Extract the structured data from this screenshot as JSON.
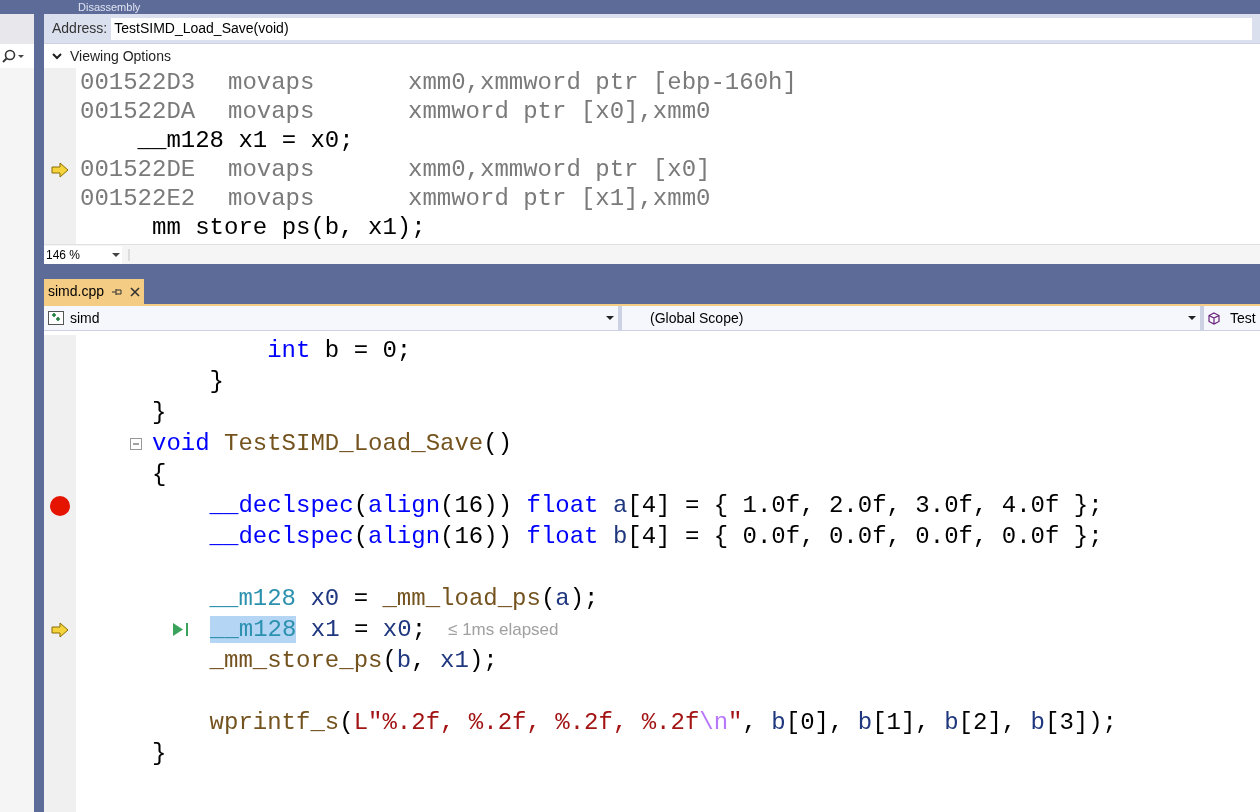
{
  "disassembly": {
    "title": "Disassembly",
    "address_label": "Address:",
    "address": "TestSIMD_Load_Save(void)",
    "viewing_options": "Viewing Options",
    "lines": [
      {
        "kind": "asm",
        "address": "001522D3",
        "mnemonic": "movaps",
        "operands": "xmm0,xmmword ptr [ebp-160h]",
        "current": false
      },
      {
        "kind": "asm",
        "address": "001522DA",
        "mnemonic": "movaps",
        "operands": "xmmword ptr [x0],xmm0",
        "current": false
      },
      {
        "kind": "source",
        "text": "    __m128 x1 = x0;"
      },
      {
        "kind": "asm",
        "address": "001522DE",
        "mnemonic": "movaps",
        "operands": "xmm0,xmmword ptr [x0]",
        "current": true
      },
      {
        "kind": "asm",
        "address": "001522E2",
        "mnemonic": "movaps",
        "operands": "xmmword ptr [x1],xmm0",
        "current": false
      },
      {
        "kind": "source",
        "text": "     mm store ps(b, x1);"
      }
    ],
    "zoom": "146 %"
  },
  "editor": {
    "tabs": [
      {
        "label": "simd.cpp",
        "selected": true
      }
    ],
    "project": "simd",
    "scope": "(Global Scope)",
    "member": "Test",
    "lines": [
      {
        "breakpoint": false,
        "current": false,
        "tokens": [
          {
            "text": "        int",
            "kind": "keyword"
          },
          {
            "text": " b = 0;",
            "kind": "plain"
          }
        ]
      },
      {
        "breakpoint": false,
        "current": false,
        "tokens": [
          {
            "text": "    }",
            "kind": "plain"
          }
        ]
      },
      {
        "breakpoint": false,
        "current": false,
        "tokens": [
          {
            "text": "}",
            "kind": "plain"
          }
        ]
      },
      {
        "breakpoint": false,
        "current": false,
        "fold": true,
        "tokens": [
          {
            "text": "void",
            "kind": "keyword"
          },
          {
            "text": " TestSIMD_Load_Save",
            "kind": "func"
          },
          {
            "text": "()",
            "kind": "plain"
          }
        ]
      },
      {
        "breakpoint": false,
        "current": false,
        "tokens": [
          {
            "text": "{",
            "kind": "plain"
          }
        ]
      },
      {
        "breakpoint": true,
        "current": false,
        "tokens": [
          {
            "text": "    __declspec",
            "kind": "keyword"
          },
          {
            "text": "(",
            "kind": "plain"
          },
          {
            "text": "align",
            "kind": "keyword"
          },
          {
            "text": "(16)) ",
            "kind": "plain"
          },
          {
            "text": "float",
            "kind": "keyword"
          },
          {
            "text": " a",
            "kind": "var"
          },
          {
            "text": "[4] = { 1.0f, 2.0f, 3.0f, 4.0f };",
            "kind": "plain"
          }
        ]
      },
      {
        "breakpoint": false,
        "current": false,
        "tokens": [
          {
            "text": "    __declspec",
            "kind": "keyword"
          },
          {
            "text": "(",
            "kind": "plain"
          },
          {
            "text": "align",
            "kind": "keyword"
          },
          {
            "text": "(16)) ",
            "kind": "plain"
          },
          {
            "text": "float",
            "kind": "keyword"
          },
          {
            "text": " b",
            "kind": "var"
          },
          {
            "text": "[4] = { 0.0f, 0.0f, 0.0f, 0.0f };",
            "kind": "plain"
          }
        ]
      },
      {
        "breakpoint": false,
        "current": false
      },
      {
        "breakpoint": false,
        "current": false,
        "tokens": [
          {
            "text": "    __m128",
            "kind": "type"
          },
          {
            "text": " x0",
            "kind": "var"
          },
          {
            "text": " = ",
            "kind": "plain"
          },
          {
            "text": "_mm_load_ps",
            "kind": "func"
          },
          {
            "text": "(",
            "kind": "plain"
          },
          {
            "text": "a",
            "kind": "var"
          },
          {
            "text": ");",
            "kind": "plain"
          }
        ]
      },
      {
        "breakpoint": false,
        "current": true,
        "run_to_click": true,
        "hint": "≤ 1ms elapsed",
        "tokens": [
          {
            "text": "__m128",
            "kind": "type",
            "selected": true
          },
          {
            "text": " x1",
            "kind": "var"
          },
          {
            "text": " = ",
            "kind": "plain"
          },
          {
            "text": "x0",
            "kind": "var"
          },
          {
            "text": ";",
            "kind": "plain"
          }
        ]
      },
      {
        "breakpoint": false,
        "current": false,
        "tokens": [
          {
            "text": "    _mm_store_ps",
            "kind": "func"
          },
          {
            "text": "(",
            "kind": "plain"
          },
          {
            "text": "b",
            "kind": "var"
          },
          {
            "text": ", ",
            "kind": "plain"
          },
          {
            "text": "x1",
            "kind": "var"
          },
          {
            "text": ");",
            "kind": "plain"
          }
        ]
      },
      {
        "breakpoint": false,
        "current": false
      },
      {
        "breakpoint": false,
        "current": false,
        "tokens": [
          {
            "text": "    wprintf_s",
            "kind": "func"
          },
          {
            "text": "(",
            "kind": "plain"
          },
          {
            "text": "L\"%.2f, %.2f, %.2f, %.2f",
            "kind": "string"
          },
          {
            "text": "\\n",
            "kind": "escape"
          },
          {
            "text": "\"",
            "kind": "string"
          },
          {
            "text": ", ",
            "kind": "plain"
          },
          {
            "text": "b",
            "kind": "var"
          },
          {
            "text": "[0], ",
            "kind": "plain"
          },
          {
            "text": "b",
            "kind": "var"
          },
          {
            "text": "[1], ",
            "kind": "plain"
          },
          {
            "text": "b",
            "kind": "var"
          },
          {
            "text": "[2], ",
            "kind": "plain"
          },
          {
            "text": "b",
            "kind": "var"
          },
          {
            "text": "[3]);",
            "kind": "plain"
          }
        ]
      },
      {
        "breakpoint": false,
        "current": false,
        "tokens": [
          {
            "text": "}",
            "kind": "plain"
          }
        ]
      }
    ]
  }
}
